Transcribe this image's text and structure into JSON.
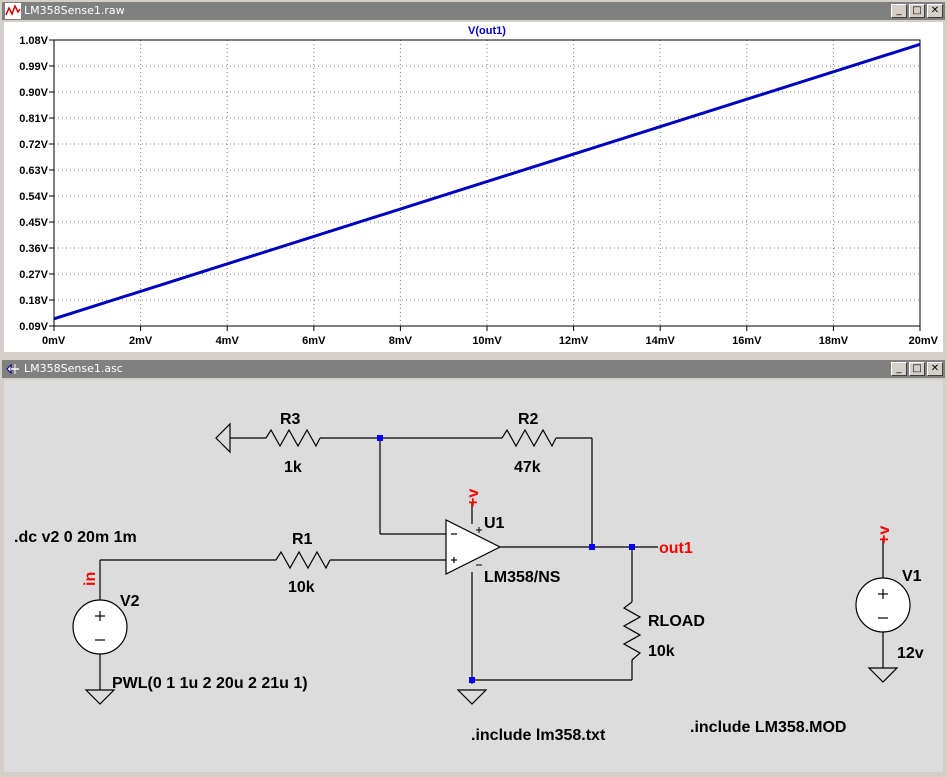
{
  "waveform_window": {
    "title": "LM358Sense1.raw",
    "trace_label": "V(out1)",
    "trace_color": "#0000c0",
    "chart_data": {
      "type": "line",
      "title": "V(out1)",
      "xlabel": "",
      "ylabel": "",
      "x_ticks": [
        "0mV",
        "2mV",
        "4mV",
        "6mV",
        "8mV",
        "10mV",
        "12mV",
        "14mV",
        "16mV",
        "18mV",
        "20mV"
      ],
      "y_ticks": [
        "0.09V",
        "0.18V",
        "0.27V",
        "0.36V",
        "0.45V",
        "0.54V",
        "0.63V",
        "0.72V",
        "0.81V",
        "0.90V",
        "0.99V",
        "1.08V"
      ],
      "xlim": [
        0,
        20
      ],
      "ylim": [
        0.09,
        1.08
      ],
      "x_unit": "mV",
      "y_unit": "V",
      "grid": true,
      "series": [
        {
          "name": "V(out1)",
          "x": [
            0,
            20
          ],
          "y": [
            0.115,
            1.065
          ]
        }
      ]
    }
  },
  "schematic_window": {
    "title": "LM358Sense1.asc",
    "labels": {
      "r3": "R3",
      "r3_value": "1k",
      "r2": "R2",
      "r2_value": "47k",
      "r1": "R1",
      "r1_value": "10k",
      "rload": "RLOAD",
      "rload_value": "10k",
      "u1": "U1",
      "u1_model": "LM358/NS",
      "v2": "V2",
      "v2_value": "PWL(0 1 1u 2 20u 2 21u 1)",
      "v1": "V1",
      "v1_value": "12v",
      "dc_directive": ".dc v2 0 20m 1m",
      "include1": ".include lm358.txt",
      "include2": ".include LM358.MOD",
      "net_in": "in",
      "net_out": "out1",
      "supply_u1": "+v",
      "supply_v1": "+v"
    }
  },
  "window_controls": {
    "minimize": "_",
    "restore": "□",
    "close": "✕"
  },
  "colors": {
    "wire": "#000000",
    "junction": "#0000ff",
    "net_label": "#ff0000",
    "trace": "#0000c0"
  }
}
